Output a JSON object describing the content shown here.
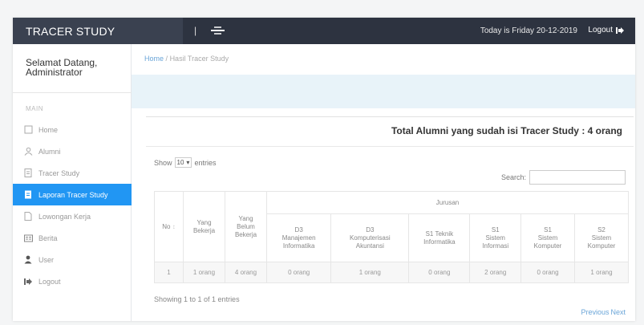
{
  "header": {
    "brand": "TRACER STUDY",
    "divider": "|",
    "today": "Today is Friday 20-12-2019",
    "logout_label": "Logout"
  },
  "sidebar": {
    "welcome_line1": "Selamat Datang,",
    "welcome_line2": "Administrator",
    "heading": "MAIN",
    "items": [
      {
        "label": "Home",
        "icon": "home-icon"
      },
      {
        "label": "Alumni",
        "icon": "user-icon"
      },
      {
        "label": "Tracer Study",
        "icon": "document-icon"
      },
      {
        "label": "Laporan Tracer Study",
        "icon": "report-icon",
        "active": true
      },
      {
        "label": "Lowongan Kerja",
        "icon": "file-icon"
      },
      {
        "label": "Berita",
        "icon": "news-icon"
      },
      {
        "label": "User",
        "icon": "person-icon"
      },
      {
        "label": "Logout",
        "icon": "logout-icon"
      }
    ]
  },
  "breadcrumb": {
    "home": "Home",
    "separator": "/",
    "current": "Hasil Tracer Study"
  },
  "panel": {
    "total_text": "Total Alumni yang sudah isi Tracer Study  : 4 orang",
    "show_label": "Show",
    "entries_value": "10",
    "entries_label": "entries",
    "search_label": "Search:"
  },
  "table": {
    "group_header": "Jurusan",
    "headers": {
      "no": "No",
      "bekerja": [
        "Yang",
        "Bekerja"
      ],
      "belum": [
        "Yang",
        "Belum",
        "Bekerja"
      ],
      "d3_mi": [
        "D3",
        "Manajemen",
        "Informatika"
      ],
      "d3_ka": [
        "D3",
        "Komputerisasi",
        "Akuntansi"
      ],
      "s1_ti": [
        "S1 Teknik",
        "Informatika"
      ],
      "s1_si": [
        "S1",
        "Sistem",
        "Informasi"
      ],
      "s1_sk": [
        "S1",
        "Sistem",
        "Komputer"
      ],
      "s2_sk": [
        "S2",
        "Sistem",
        "Komputer"
      ]
    },
    "rows": [
      [
        "1",
        "1 orang",
        "4 orang",
        "0 orang",
        "1 orang",
        "0 orang",
        "2 orang",
        "0 orang",
        "1 orang"
      ]
    ]
  },
  "footer": {
    "showing": "Showing 1 to 1 of 1 entries",
    "previous": "Previous",
    "next": "Next"
  }
}
